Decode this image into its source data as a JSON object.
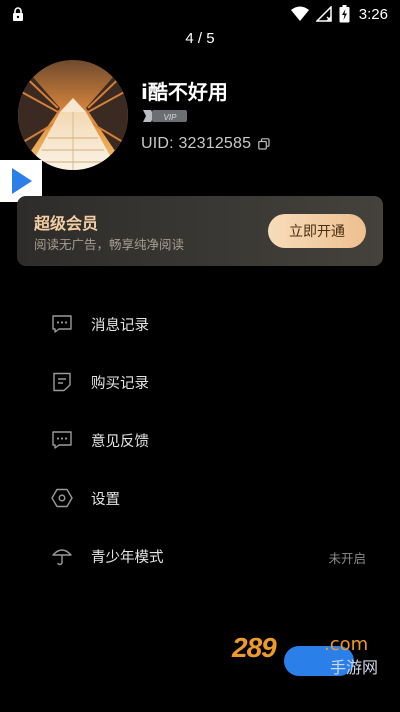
{
  "status_bar": {
    "time": "3:26"
  },
  "page_indicator": "4 / 5",
  "profile": {
    "username": "i酷不好用",
    "vip_badge": "VIP",
    "uid": "UID: 32312585"
  },
  "vip_card": {
    "title": "超级会员",
    "description": "阅读无广告，畅享纯净阅读",
    "button": "立即开通",
    "colors": {
      "title": "#f2cfa4",
      "button_bg": "#f0c491",
      "button_text": "#4a2d14"
    }
  },
  "menu": [
    {
      "label": "消息记录",
      "icon": "message-icon"
    },
    {
      "label": "购买记录",
      "icon": "purchase-record-icon"
    },
    {
      "label": "意见反馈",
      "icon": "feedback-icon"
    },
    {
      "label": "设置",
      "icon": "settings-icon"
    },
    {
      "label": "青少年模式",
      "icon": "umbrella-icon",
      "value": "未开启"
    }
  ],
  "watermark": {
    "text": "289",
    "domain": ".com",
    "sub": "手游网"
  }
}
